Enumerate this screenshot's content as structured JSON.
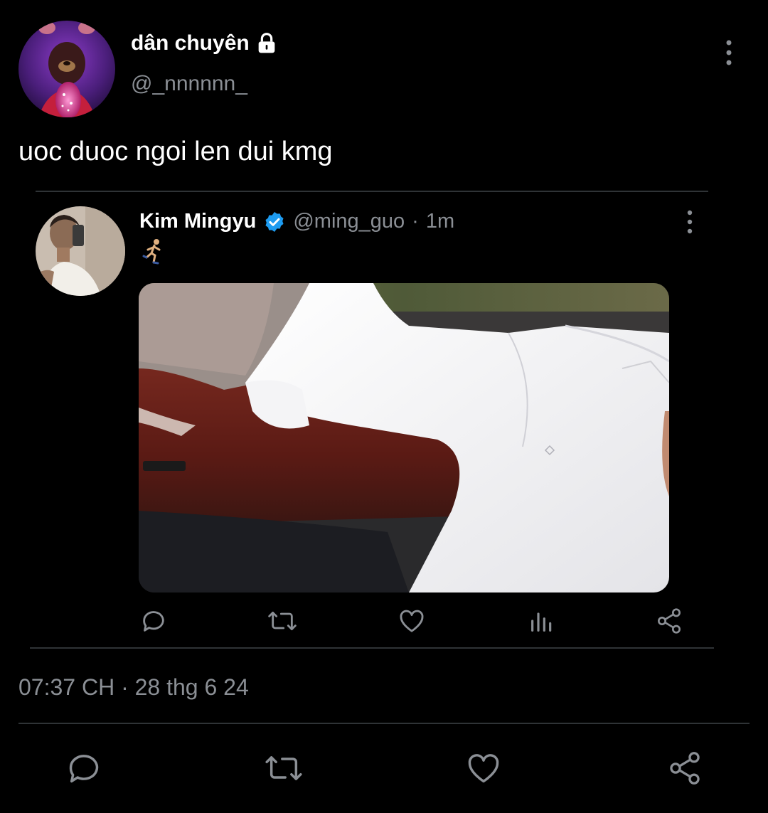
{
  "tweet": {
    "author_name": "dân chuyên",
    "author_handle": "@_nnnnnn_",
    "text": "uoc duoc ngoi len dui kmg",
    "timestamp": "07:37 CH · 28 thg 6 24",
    "protected": true
  },
  "quoted": {
    "author_name": "Kim Mingyu",
    "verified": true,
    "handle": "@ming_guo",
    "time_sep": "·",
    "time": "1m",
    "emoji": "person-running"
  },
  "icons": {
    "lock": "lock-icon",
    "more": "more-vertical-icon",
    "verified": "verified-badge-icon",
    "reply": "reply-icon",
    "retweet": "retweet-icon",
    "like": "heart-icon",
    "views": "views-icon",
    "share": "share-icon"
  },
  "colors": {
    "background": "#000000",
    "text": "#ffffff",
    "muted": "#8b8f95",
    "verified": "#1d9bf0",
    "divider": "#2f3336"
  }
}
